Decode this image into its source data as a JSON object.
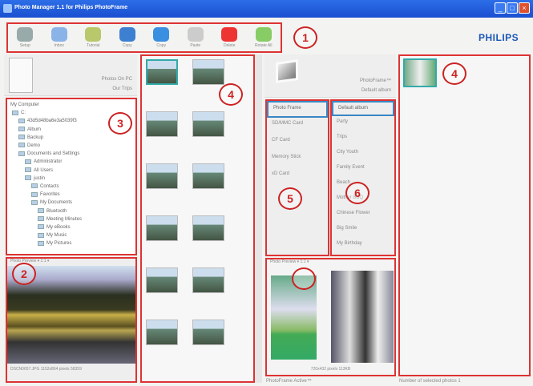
{
  "window": {
    "title": "Photo Manager 1.1 for Philips PhotoFrame",
    "controls": [
      "minimize",
      "maximize",
      "close"
    ]
  },
  "toolbar": {
    "items": [
      {
        "label": "Setup",
        "icon": "gear-icon",
        "color": "#9aa"
      },
      {
        "label": "Inbox",
        "icon": "chat-icon",
        "color": "#8ab4e8"
      },
      {
        "label": "Tutorial",
        "icon": "pen-icon",
        "color": "#b8c86a"
      },
      {
        "label": "Copy",
        "icon": "copy-icon",
        "color": "#3d7fd0"
      },
      {
        "label": "Copy",
        "icon": "frame-icon",
        "color": "#3a8fe0"
      },
      {
        "label": "Paste",
        "icon": "paste-icon",
        "color": "#ccc"
      },
      {
        "label": "Delete",
        "icon": "delete-icon",
        "color": "#e33"
      },
      {
        "label": "Rotate All",
        "icon": "map-icon",
        "color": "#8c6"
      }
    ]
  },
  "brand": "PHILIPS",
  "pc": {
    "label": "Photos On PC",
    "sub": "Our Trips"
  },
  "tree": {
    "root": "My Computer",
    "items": [
      {
        "label": "C:",
        "depth": 0
      },
      {
        "label": "43d5d48ba6e3a5039f3",
        "depth": 1
      },
      {
        "label": "Album",
        "depth": 1
      },
      {
        "label": "Backup",
        "depth": 1
      },
      {
        "label": "Demo",
        "depth": 1
      },
      {
        "label": "Documents and Settings",
        "depth": 1
      },
      {
        "label": "Administrator",
        "depth": 2
      },
      {
        "label": "All Users",
        "depth": 2
      },
      {
        "label": "justin",
        "depth": 2
      },
      {
        "label": "Contacts",
        "depth": 3
      },
      {
        "label": "Favorites",
        "depth": 3
      },
      {
        "label": "My Documents",
        "depth": 3
      },
      {
        "label": "Bluetooth",
        "depth": 4
      },
      {
        "label": "Meeting Minutes",
        "depth": 4
      },
      {
        "label": "My eBooks",
        "depth": 4
      },
      {
        "label": "My Music",
        "depth": 4
      },
      {
        "label": "My Pictures",
        "depth": 4
      }
    ]
  },
  "pc_preview": {
    "toolbar": "Photo Preview  ▾  1:1 ▾",
    "info": "DSCN0657.JPG   1152x864 pixels   58359"
  },
  "frame": {
    "label": "PhotoFrame™",
    "sub": "Default album"
  },
  "sources": [
    "Photo Frame",
    "SD/MMC Card",
    "CF Card",
    "Memory Stick",
    "xD Card"
  ],
  "albums": [
    "Default album",
    "Party",
    "Trips",
    "City Youth",
    "Family Event",
    "Beach",
    "Mother BBQ",
    "Chinese Flower",
    "Big Smile",
    "My Birthday"
  ],
  "frame_preview": {
    "toolbar": "Photo Preview  ▾  1:1 ▾",
    "info": "720x432 pixels   113KB"
  },
  "status": {
    "left": "PhotoFrame Active™",
    "right": "Number of selected photos 1"
  },
  "callouts": [
    "1",
    "2",
    "3",
    "4",
    "4",
    "5",
    "6"
  ]
}
